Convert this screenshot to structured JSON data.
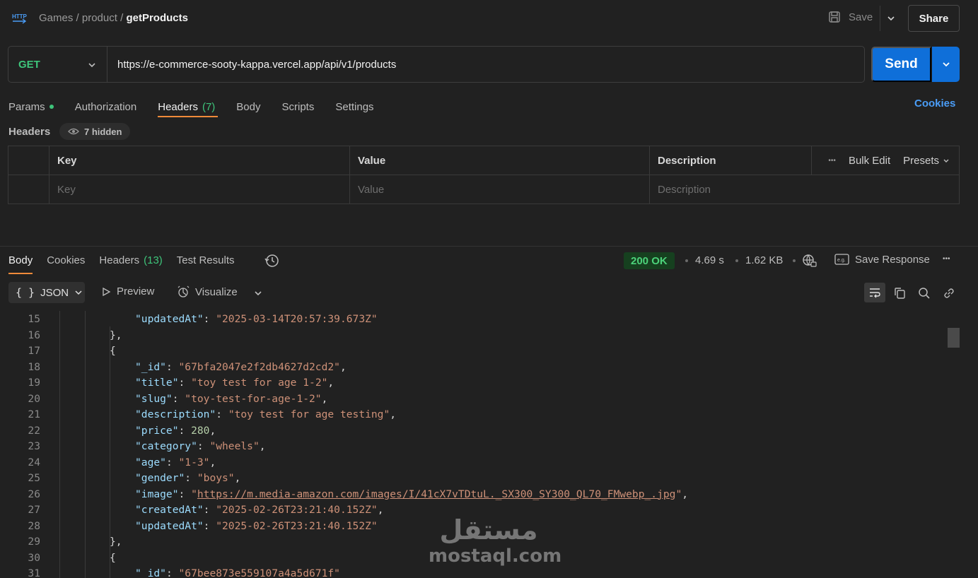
{
  "breadcrumb": {
    "items": [
      "Games",
      "product"
    ],
    "current": "getProducts",
    "sep": " / "
  },
  "toolbar": {
    "save_label": "Save",
    "share_label": "Share"
  },
  "request": {
    "method": "GET",
    "url": "https://e-commerce-sooty-kappa.vercel.app/api/v1/products",
    "send_label": "Send"
  },
  "request_tabs": {
    "params": "Params",
    "authorization": "Authorization",
    "headers": "Headers",
    "headers_count": "(7)",
    "body": "Body",
    "scripts": "Scripts",
    "settings": "Settings",
    "cookies": "Cookies"
  },
  "headers_section": {
    "title": "Headers",
    "hidden": "7 hidden",
    "columns": {
      "key": "Key",
      "value": "Value",
      "description": "Description"
    },
    "placeholders": {
      "key": "Key",
      "value": "Value",
      "description": "Description"
    },
    "bulk_edit": "Bulk Edit",
    "presets": "Presets",
    "more": "•••"
  },
  "response_tabs": {
    "body": "Body",
    "cookies": "Cookies",
    "headers": "Headers",
    "headers_count": "(13)",
    "test_results": "Test Results"
  },
  "response_meta": {
    "status": "200 OK",
    "time": "4.69 s",
    "size": "1.62 KB",
    "save_response": "Save Response",
    "more": "•••"
  },
  "viewer": {
    "format": "JSON",
    "preview": "Preview",
    "visualize": "Visualize"
  },
  "code_lines": [
    {
      "n": "15",
      "i": 3,
      "t": [
        [
          "k",
          "\"updatedAt\""
        ],
        [
          "p",
          ": "
        ],
        [
          "s",
          "\"2025-03-14T20:57:39.673Z\""
        ]
      ]
    },
    {
      "n": "16",
      "i": 2,
      "t": [
        [
          "p",
          "},"
        ]
      ]
    },
    {
      "n": "17",
      "i": 2,
      "t": [
        [
          "p",
          "{"
        ]
      ]
    },
    {
      "n": "18",
      "i": 3,
      "t": [
        [
          "k",
          "\"_id\""
        ],
        [
          "p",
          ": "
        ],
        [
          "s",
          "\"67bfa2047e2f2db4627d2cd2\""
        ],
        [
          "p",
          ","
        ]
      ]
    },
    {
      "n": "19",
      "i": 3,
      "t": [
        [
          "k",
          "\"title\""
        ],
        [
          "p",
          ": "
        ],
        [
          "s",
          "\"toy test for age 1-2\""
        ],
        [
          "p",
          ","
        ]
      ]
    },
    {
      "n": "20",
      "i": 3,
      "t": [
        [
          "k",
          "\"slug\""
        ],
        [
          "p",
          ": "
        ],
        [
          "s",
          "\"toy-test-for-age-1-2\""
        ],
        [
          "p",
          ","
        ]
      ]
    },
    {
      "n": "21",
      "i": 3,
      "t": [
        [
          "k",
          "\"description\""
        ],
        [
          "p",
          ": "
        ],
        [
          "s",
          "\"toy test for age testing\""
        ],
        [
          "p",
          ","
        ]
      ]
    },
    {
      "n": "22",
      "i": 3,
      "t": [
        [
          "k",
          "\"price\""
        ],
        [
          "p",
          ": "
        ],
        [
          "n",
          "280"
        ],
        [
          "p",
          ","
        ]
      ]
    },
    {
      "n": "23",
      "i": 3,
      "t": [
        [
          "k",
          "\"category\""
        ],
        [
          "p",
          ": "
        ],
        [
          "s",
          "\"wheels\""
        ],
        [
          "p",
          ","
        ]
      ]
    },
    {
      "n": "24",
      "i": 3,
      "t": [
        [
          "k",
          "\"age\""
        ],
        [
          "p",
          ": "
        ],
        [
          "s",
          "\"1-3\""
        ],
        [
          "p",
          ","
        ]
      ]
    },
    {
      "n": "25",
      "i": 3,
      "t": [
        [
          "k",
          "\"gender\""
        ],
        [
          "p",
          ": "
        ],
        [
          "s",
          "\"boys\""
        ],
        [
          "p",
          ","
        ]
      ]
    },
    {
      "n": "26",
      "i": 3,
      "t": [
        [
          "k",
          "\"image\""
        ],
        [
          "p",
          ": "
        ],
        [
          "s",
          "\""
        ],
        [
          "u",
          "https://m.media-amazon.com/images/I/41cX7vTDtuL._SX300_SY300_QL70_FMwebp_.jpg"
        ],
        [
          "s",
          "\""
        ],
        [
          "p",
          ","
        ]
      ]
    },
    {
      "n": "27",
      "i": 3,
      "t": [
        [
          "k",
          "\"createdAt\""
        ],
        [
          "p",
          ": "
        ],
        [
          "s",
          "\"2025-02-26T23:21:40.152Z\""
        ],
        [
          "p",
          ","
        ]
      ]
    },
    {
      "n": "28",
      "i": 3,
      "t": [
        [
          "k",
          "\"updatedAt\""
        ],
        [
          "p",
          ": "
        ],
        [
          "s",
          "\"2025-02-26T23:21:40.152Z\""
        ]
      ]
    },
    {
      "n": "29",
      "i": 2,
      "t": [
        [
          "p",
          "},"
        ]
      ]
    },
    {
      "n": "30",
      "i": 2,
      "t": [
        [
          "p",
          "{"
        ]
      ]
    },
    {
      "n": "31",
      "i": 3,
      "t": [
        [
          "k",
          "\"_id\""
        ],
        [
          "p",
          ": "
        ],
        [
          "s",
          "\"67bee873e559107a4a5d671f\""
        ]
      ]
    }
  ],
  "watermark": {
    "arabic": "مستقل",
    "latin": "mostaql.com"
  },
  "colors": {
    "accent": "#f08a3a",
    "primary": "#0f6fd9",
    "method": "#3ec47a",
    "link": "#4a9df7"
  }
}
